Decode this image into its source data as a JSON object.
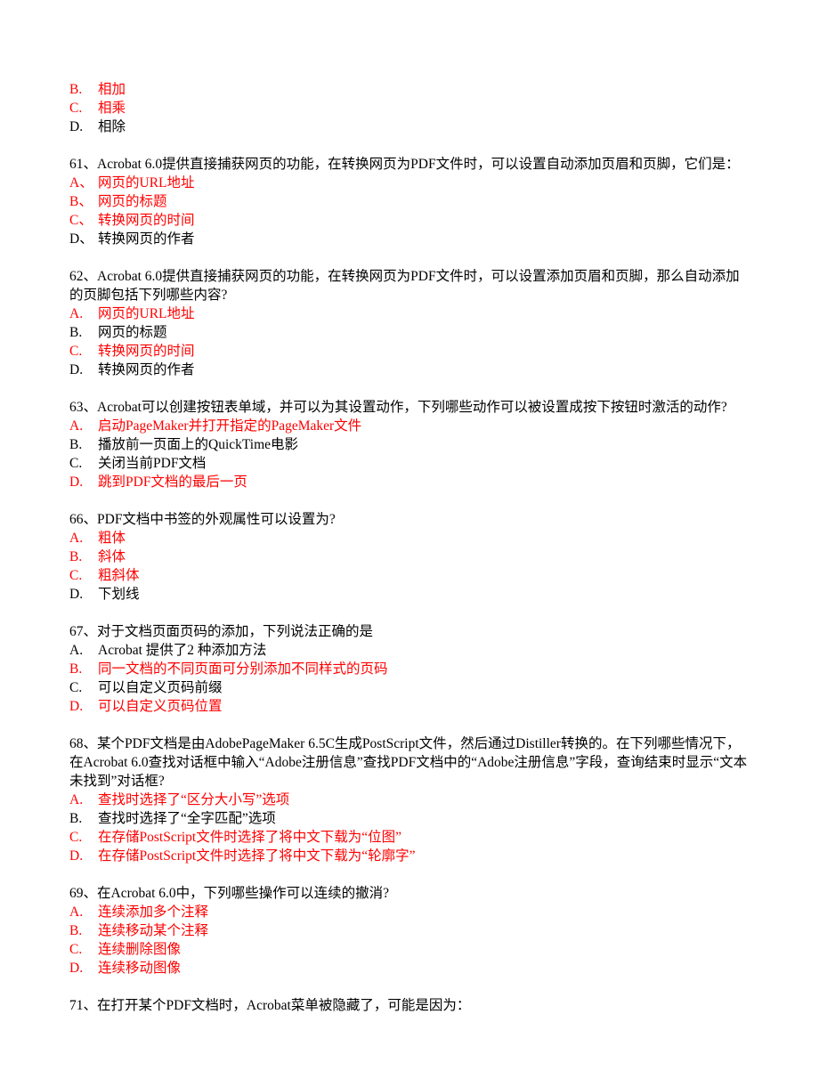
{
  "topOptions": [
    {
      "letter": "B.",
      "text": "相加",
      "cls": "red"
    },
    {
      "letter": "C.",
      "text": "相乘",
      "cls": "red"
    },
    {
      "letter": "D.",
      "text": "相除",
      "cls": "black"
    }
  ],
  "questions": [
    {
      "stem": "61、Acrobat 6.0提供直接捕获网页的功能，在转换网页为PDF文件时，可以设置自动添加页眉和页脚，它们是：",
      "options": [
        {
          "letter": "A、",
          "text": "网页的URL地址",
          "cls": "red"
        },
        {
          "letter": "B、",
          "text": "网页的标题",
          "cls": "red"
        },
        {
          "letter": "C、",
          "text": "转换网页的时间",
          "cls": "red"
        },
        {
          "letter": "D、",
          "text": "转换网页的作者",
          "cls": "black"
        }
      ]
    },
    {
      "stem": "62、Acrobat 6.0提供直接捕获网页的功能，在转换网页为PDF文件时，可以设置添加页眉和页脚，那么自动添加的页脚包括下列哪些内容?",
      "options": [
        {
          "letter": "A.",
          "text": "网页的URL地址",
          "cls": "red"
        },
        {
          "letter": "B.",
          "text": "网页的标题",
          "cls": "black"
        },
        {
          "letter": "C.",
          "text": "转换网页的时间",
          "cls": "red"
        },
        {
          "letter": "D.",
          "text": "转换网页的作者",
          "cls": "black"
        }
      ]
    },
    {
      "stem": "63、Acrobat可以创建按钮表单域，并可以为其设置动作，下列哪些动作可以被设置成按下按钮时激活的动作?",
      "options": [
        {
          "letter": "A.",
          "text": "启动PageMaker并打开指定的PageMaker文件",
          "cls": "red"
        },
        {
          "letter": "B.",
          "text": "播放前一页面上的QuickTime电影",
          "cls": "black"
        },
        {
          "letter": "C.",
          "text": "关闭当前PDF文档",
          "cls": "black"
        },
        {
          "letter": "D.",
          "text": "跳到PDF文档的最后一页",
          "cls": "red"
        }
      ]
    },
    {
      "stem": "66、PDF文档中书签的外观属性可以设置为?",
      "options": [
        {
          "letter": "A.",
          "text": "粗体",
          "cls": "red"
        },
        {
          "letter": "B.",
          "text": "斜体",
          "cls": "red"
        },
        {
          "letter": "C.",
          "text": "粗斜体",
          "cls": "red"
        },
        {
          "letter": "D.",
          "text": "下划线",
          "cls": "black"
        }
      ]
    },
    {
      "stem": "67、对于文档页面页码的添加，下列说法正确的是",
      "options": [
        {
          "letter": "A.",
          "text": "Acrobat 提供了2 种添加方法",
          "cls": "black"
        },
        {
          "letter": "B.",
          "text": "同一文档的不同页面可分别添加不同样式的页码",
          "cls": "red"
        },
        {
          "letter": "C.",
          "text": "可以自定义页码前缀",
          "cls": "black"
        },
        {
          "letter": "D.",
          "text": "可以自定义页码位置",
          "cls": "red"
        }
      ]
    },
    {
      "stem": "68、某个PDF文档是由AdobePageMaker 6.5C生成PostScript文件，然后通过Distiller转换的。在下列哪些情况下，在Acrobat 6.0查找对话框中输入“Adobe注册信息”查找PDF文档中的“Adobe注册信息”字段，查询结束时显示“文本未找到”对话框?",
      "options": [
        {
          "letter": "A.",
          "text": "查找时选择了“区分大小写”选项",
          "cls": "red"
        },
        {
          "letter": "B.",
          "text": "查找时选择了“全字匹配”选项",
          "cls": "black"
        },
        {
          "letter": "C.",
          "text": "在存储PostScript文件时选择了将中文下载为“位图”",
          "cls": "red"
        },
        {
          "letter": "D.",
          "text": "在存储PostScript文件时选择了将中文下载为“轮廓字”",
          "cls": "red"
        }
      ]
    },
    {
      "stem": "69、在Acrobat 6.0中，下列哪些操作可以连续的撤消?",
      "options": [
        {
          "letter": "A.",
          "text": "连续添加多个注释",
          "cls": "red"
        },
        {
          "letter": "B.",
          "text": "连续移动某个注释",
          "cls": "red"
        },
        {
          "letter": "C.",
          "text": "连续删除图像",
          "cls": "red"
        },
        {
          "letter": "D.",
          "text": "连续移动图像",
          "cls": "red"
        }
      ]
    },
    {
      "stem": "71、在打开某个PDF文档时，Acrobat菜单被隐藏了，可能是因为：",
      "options": []
    }
  ]
}
